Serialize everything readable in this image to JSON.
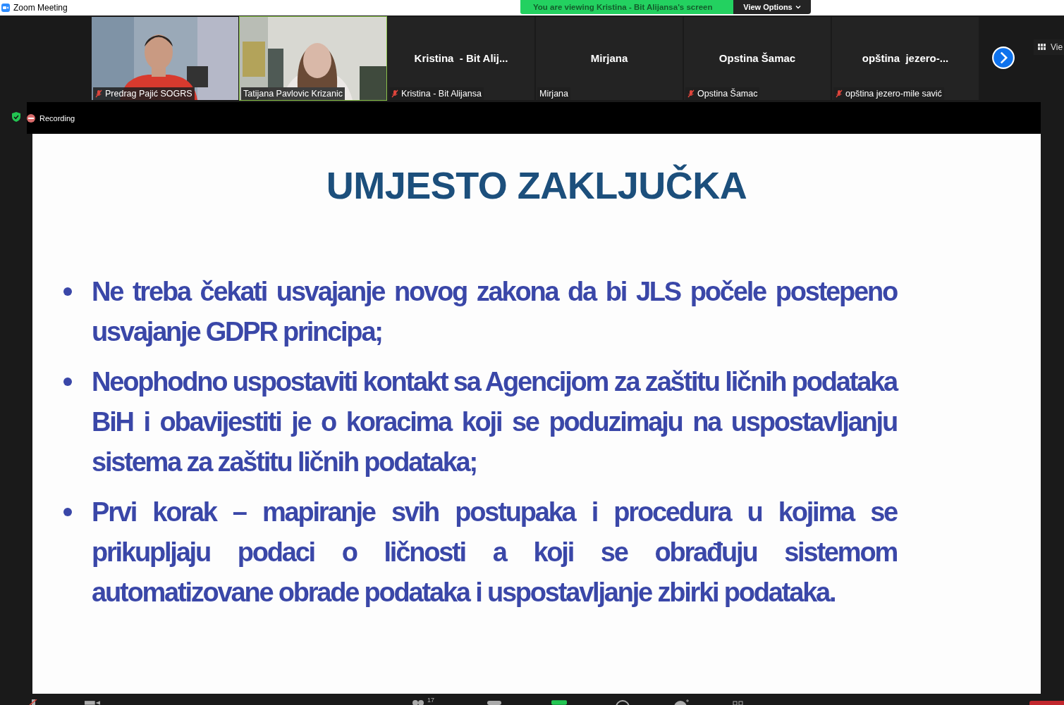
{
  "window": {
    "title": "Zoom Meeting"
  },
  "share_banner": {
    "text": "You are viewing Kristina - Bit Alijansa's screen",
    "button": "View Options"
  },
  "participants": [
    {
      "kind": "video",
      "label": "Predrag Pajić SOGRS",
      "muted": true,
      "speaking": false
    },
    {
      "kind": "video",
      "label": "Tatijana Pavlovic Krizanic",
      "muted": false,
      "speaking": true
    },
    {
      "kind": "name",
      "display": "Kristina  - Bit Alij...",
      "label": "Kristina - Bit Alijansa",
      "muted": true,
      "speaking": false
    },
    {
      "kind": "name",
      "display": "Mirjana",
      "label": "Mirjana",
      "muted": false,
      "speaking": false
    },
    {
      "kind": "name",
      "display": "Opstina Šamac",
      "label": "Opstina Šamac",
      "muted": true,
      "speaking": false
    },
    {
      "kind": "name",
      "display": "opština  jezero-...",
      "label": "opština jezero-mile savić",
      "muted": true,
      "speaking": false
    }
  ],
  "view_button": "Vie",
  "recording": {
    "label": "Recording"
  },
  "slide": {
    "title": "UMJESTO ZAKLJUČKA",
    "bullets": [
      "Ne treba čekati usvajanje novog zakona da bi JLS počele postepeno usvajanje GDPR principa;",
      "Neophodno uspostaviti kontakt sa Agencijom za zaštitu ličnih podataka BiH i obavijestiti je o koracima koji se poduzimaju na uspostavljanju sistema za zaštitu ličnih podataka;",
      "Prvi korak – mapiranje svih postupaka i procedura u kojima se prikupljaju podaci o ličnosti a koji se obrađuju sistemom automatizovane obrade podataka i uspostavljanje zbirki podataka."
    ]
  },
  "toolbar": {
    "participants_count": "17"
  }
}
